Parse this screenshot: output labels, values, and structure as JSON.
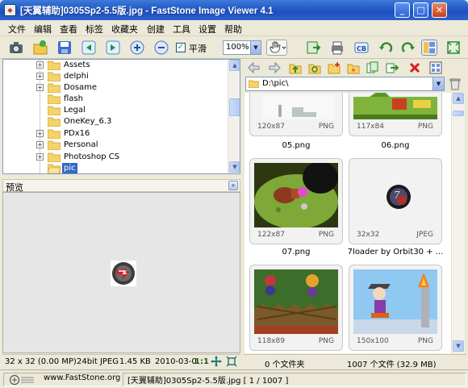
{
  "window": {
    "title": "[天翼辅助]0305Sp2-5.5版.jpg  -  FastStone Image Viewer 4.1",
    "minimize": "_",
    "maximize": "□",
    "close": "✕"
  },
  "menu": {
    "items": [
      "文件",
      "编辑",
      "查看",
      "标签",
      "收藏夹",
      "创建",
      "工具",
      "设置",
      "帮助"
    ]
  },
  "toolbar": {
    "smooth_label": "平滑",
    "zoom_value": "100%",
    "icons": [
      "camera-icon",
      "open-folder-icon",
      "save-icon",
      "prev-icon",
      "next-icon",
      "zoom-in-icon",
      "zoom-out-icon",
      "hand-tool-icon",
      "export-icon",
      "print-icon",
      "batch-icon",
      "rotate-left-icon",
      "rotate-right-icon",
      "browser-layout-icon",
      "fullscreen-icon"
    ]
  },
  "tree": {
    "items": [
      {
        "label": "Assets",
        "expandable": true
      },
      {
        "label": "delphi",
        "expandable": true
      },
      {
        "label": "Dosame",
        "expandable": true
      },
      {
        "label": "flash",
        "expandable": false
      },
      {
        "label": "Legal",
        "expandable": false
      },
      {
        "label": "OneKey_6.3",
        "expandable": false
      },
      {
        "label": "PDx16",
        "expandable": true
      },
      {
        "label": "Personal",
        "expandable": true
      },
      {
        "label": "Photoshop CS",
        "expandable": true
      },
      {
        "label": "pic",
        "expandable": false,
        "selected": true
      }
    ]
  },
  "preview": {
    "title": "预览"
  },
  "status_left": {
    "dims": "32 x 32 (0.00 MP)",
    "bit_type": "24bit JPEG",
    "size": "1.45 KB",
    "date": "2010-03-0",
    "ratio": "1:1"
  },
  "browser": {
    "path": "D:\\pic\\"
  },
  "thumbnails": [
    {
      "dims": "120x87",
      "format": "PNG",
      "name": "",
      "color": "#dfe8df"
    },
    {
      "dims": "117x84",
      "format": "PNG",
      "name": "",
      "color": "#7fb33c"
    },
    {
      "dims": "",
      "format": "",
      "name": "05.png"
    },
    {
      "dims": "",
      "format": "",
      "name": "06.png"
    },
    {
      "dims": "122x87",
      "format": "PNG",
      "name": "07.png",
      "color": "#2f3d14"
    },
    {
      "dims": "32x32",
      "format": "JPEG",
      "name": "7loader by Orbit30 + ...",
      "color": "#111111"
    },
    {
      "dims": "118x89",
      "format": "PNG",
      "name": "",
      "color": "#3a6c2a"
    },
    {
      "dims": "150x100",
      "format": "PNG",
      "name": "",
      "color": "#8fc8f0"
    }
  ],
  "status_right": {
    "folders": "0 个文件夹",
    "files": "1007 个文件 (32.9 MB)"
  },
  "bottom": {
    "website": "www.FastStone.org",
    "current": "[天翼辅助]0305Sp2-5.5版.jpg [ 1 / 1007 ]"
  }
}
